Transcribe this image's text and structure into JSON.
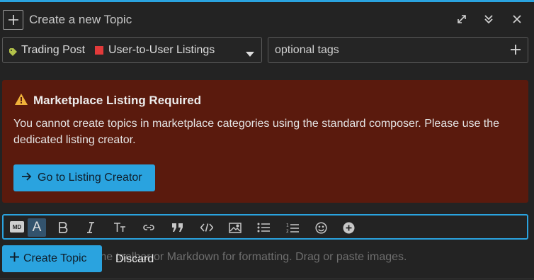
{
  "colors": {
    "accent": "#2aa3df",
    "alert_bg": "#5a1a0d",
    "category_swatch": "#e23a3a",
    "background": "#232323"
  },
  "composer": {
    "title": "Create a new Topic",
    "header_icons": [
      "plus-icon",
      "expand-icon",
      "collapse-icon",
      "close-icon"
    ]
  },
  "category": {
    "parent": "Trading Post",
    "child": "User-to-User Listings"
  },
  "tags": {
    "placeholder": "optional tags"
  },
  "alert": {
    "title": "Marketplace Listing Required",
    "body": "You cannot create topics in marketplace categories using the standard composer. Please use the dedicated listing creator.",
    "button": "Go to Listing Creator"
  },
  "toolbar": {
    "items": [
      "markdown-mode",
      "rich-text-mode",
      "bold",
      "italic",
      "heading",
      "link",
      "quote",
      "code",
      "image",
      "bullet-list",
      "numbered-list",
      "emoji",
      "more"
    ],
    "md_label": "MD",
    "rich_label": "A"
  },
  "editor": {
    "placeholder": "Type here. Use the toolbar or Markdown for formatting. Drag or paste images."
  },
  "actions": {
    "create": "Create Topic",
    "discard": "Discard"
  }
}
